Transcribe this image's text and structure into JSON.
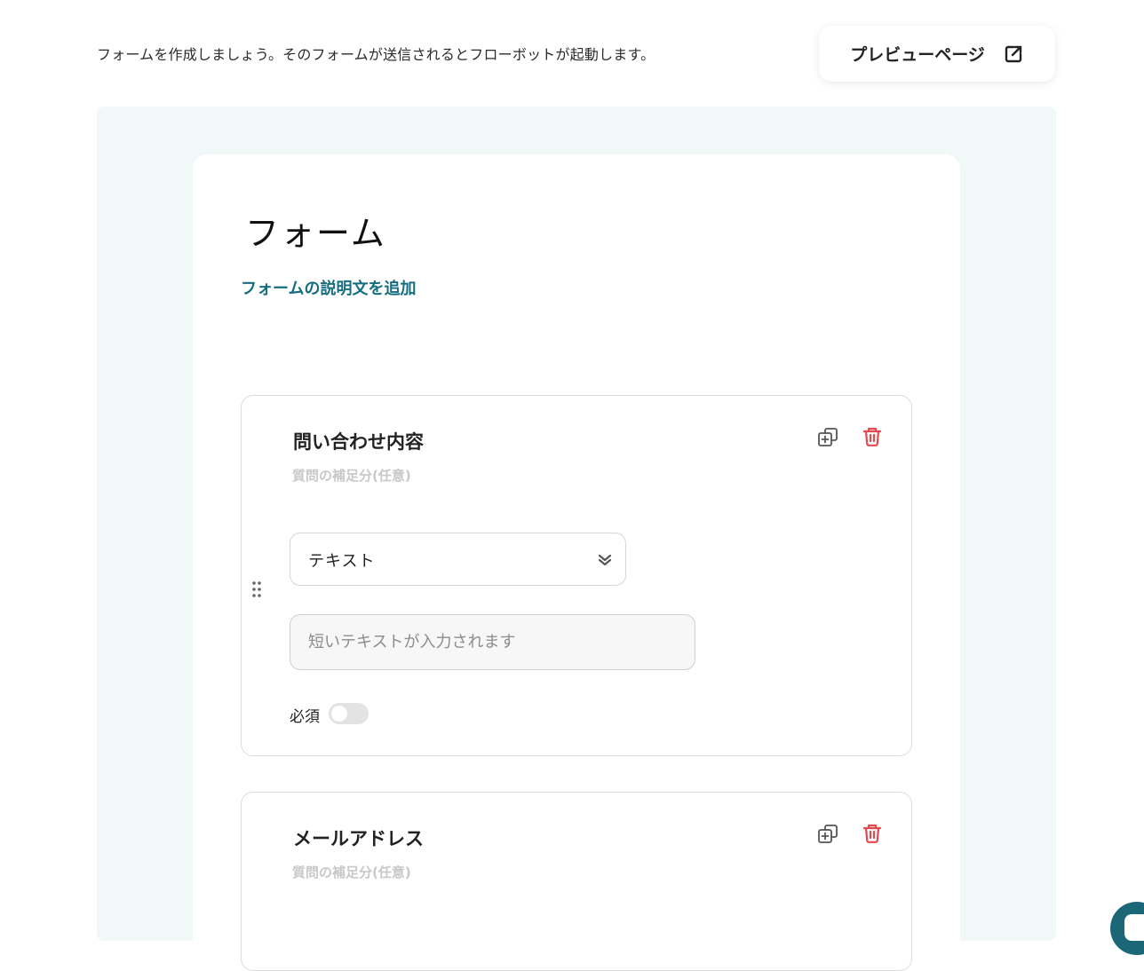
{
  "intro_text": "フォームを作成しましょう。そのフォームが送信されるとフローボットが起動します。",
  "preview_button": {
    "label": "プレビューページ",
    "icon": "external-link-icon"
  },
  "form": {
    "title": "フォーム",
    "add_description_label": "フォームの説明文を追加"
  },
  "questions": [
    {
      "title": "問い合わせ内容",
      "subtitle": "質問の補足分(任意)",
      "type_label": "テキスト",
      "answer_placeholder": "短いテキストが入力されます",
      "required_label": "必須",
      "required": false
    },
    {
      "title": "メールアドレス",
      "subtitle": "質問の補足分(任意)"
    }
  ],
  "colors": {
    "accent": "#156d80",
    "canvas_bg": "#f1f9f8",
    "delete": "#e5484d",
    "chat_bubble": "#1b6777"
  }
}
